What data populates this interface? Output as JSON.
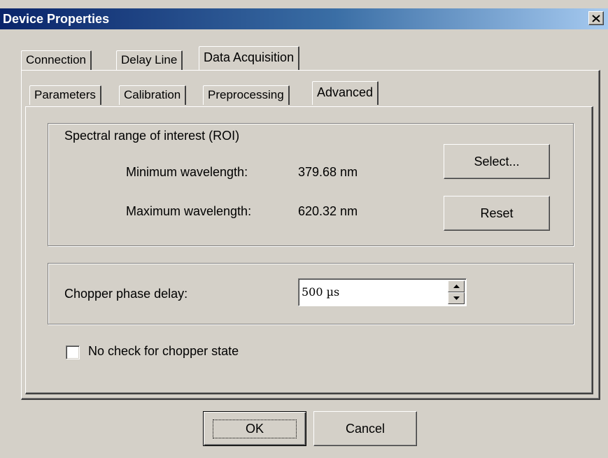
{
  "window": {
    "title": "Device Properties"
  },
  "tabs_outer": [
    "Connection",
    "Delay Line",
    "Data Acquisition"
  ],
  "tabs_inner": [
    "Parameters",
    "Calibration",
    "Preprocessing",
    "Advanced"
  ],
  "active_outer_tab": "Data Acquisition",
  "active_inner_tab": "Advanced",
  "roi": {
    "title": "Spectral range of interest (ROI)",
    "min_label": "Minimum wavelength:",
    "min_value": "379.68 nm",
    "max_label": "Maximum wavelength:",
    "max_value": "620.32 nm",
    "select_label": "Select...",
    "reset_label": "Reset"
  },
  "chopper": {
    "label": "Chopper phase delay:",
    "value": "500 µs"
  },
  "no_check": {
    "label": "No check for chopper state",
    "checked": false
  },
  "buttons": {
    "ok": "OK",
    "cancel": "Cancel"
  },
  "colors": {
    "face": "#d4d0c8",
    "title_start": "#0a246a",
    "title_end": "#a6caf0",
    "title_text": "#ffffff"
  }
}
